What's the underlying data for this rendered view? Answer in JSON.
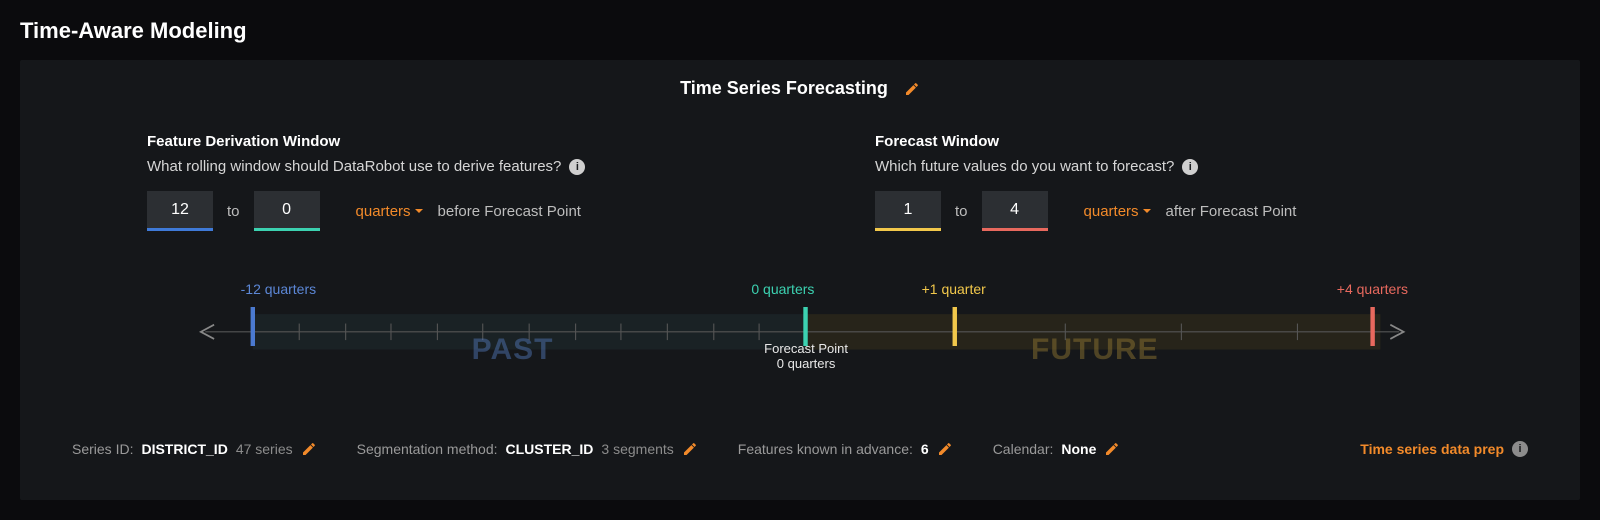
{
  "page": {
    "title": "Time-Aware Modeling",
    "section_title": "Time Series Forecasting"
  },
  "fdw": {
    "heading": "Feature Derivation Window",
    "question": "What rolling window should DataRobot use to derive features?",
    "from": "12",
    "to": "0",
    "join": "to",
    "unit": "quarters",
    "suffix": "before Forecast Point"
  },
  "fw": {
    "heading": "Forecast Window",
    "question": "Which future values do you want to forecast?",
    "from": "1",
    "to": "4",
    "join": "to",
    "unit": "quarters",
    "suffix": "after Forecast Point"
  },
  "timeline": {
    "past_start": "-12 quarters",
    "past_end": "0 quarters",
    "future_start": "+1 quarter",
    "future_end": "+4 quarters",
    "forecast_point_label": "Forecast Point",
    "forecast_point_value": "0 quarters",
    "past_word": "PAST",
    "future_word": "FUTURE"
  },
  "footer": {
    "series_id_label": "Series ID:",
    "series_id_value": "DISTRICT_ID",
    "series_count": "47 series",
    "seg_label": "Segmentation method:",
    "seg_value": "CLUSTER_ID",
    "seg_count": "3 segments",
    "kia_label": "Features known in advance:",
    "kia_value": "6",
    "cal_label": "Calendar:",
    "cal_value": "None",
    "prep_link": "Time series data prep"
  }
}
